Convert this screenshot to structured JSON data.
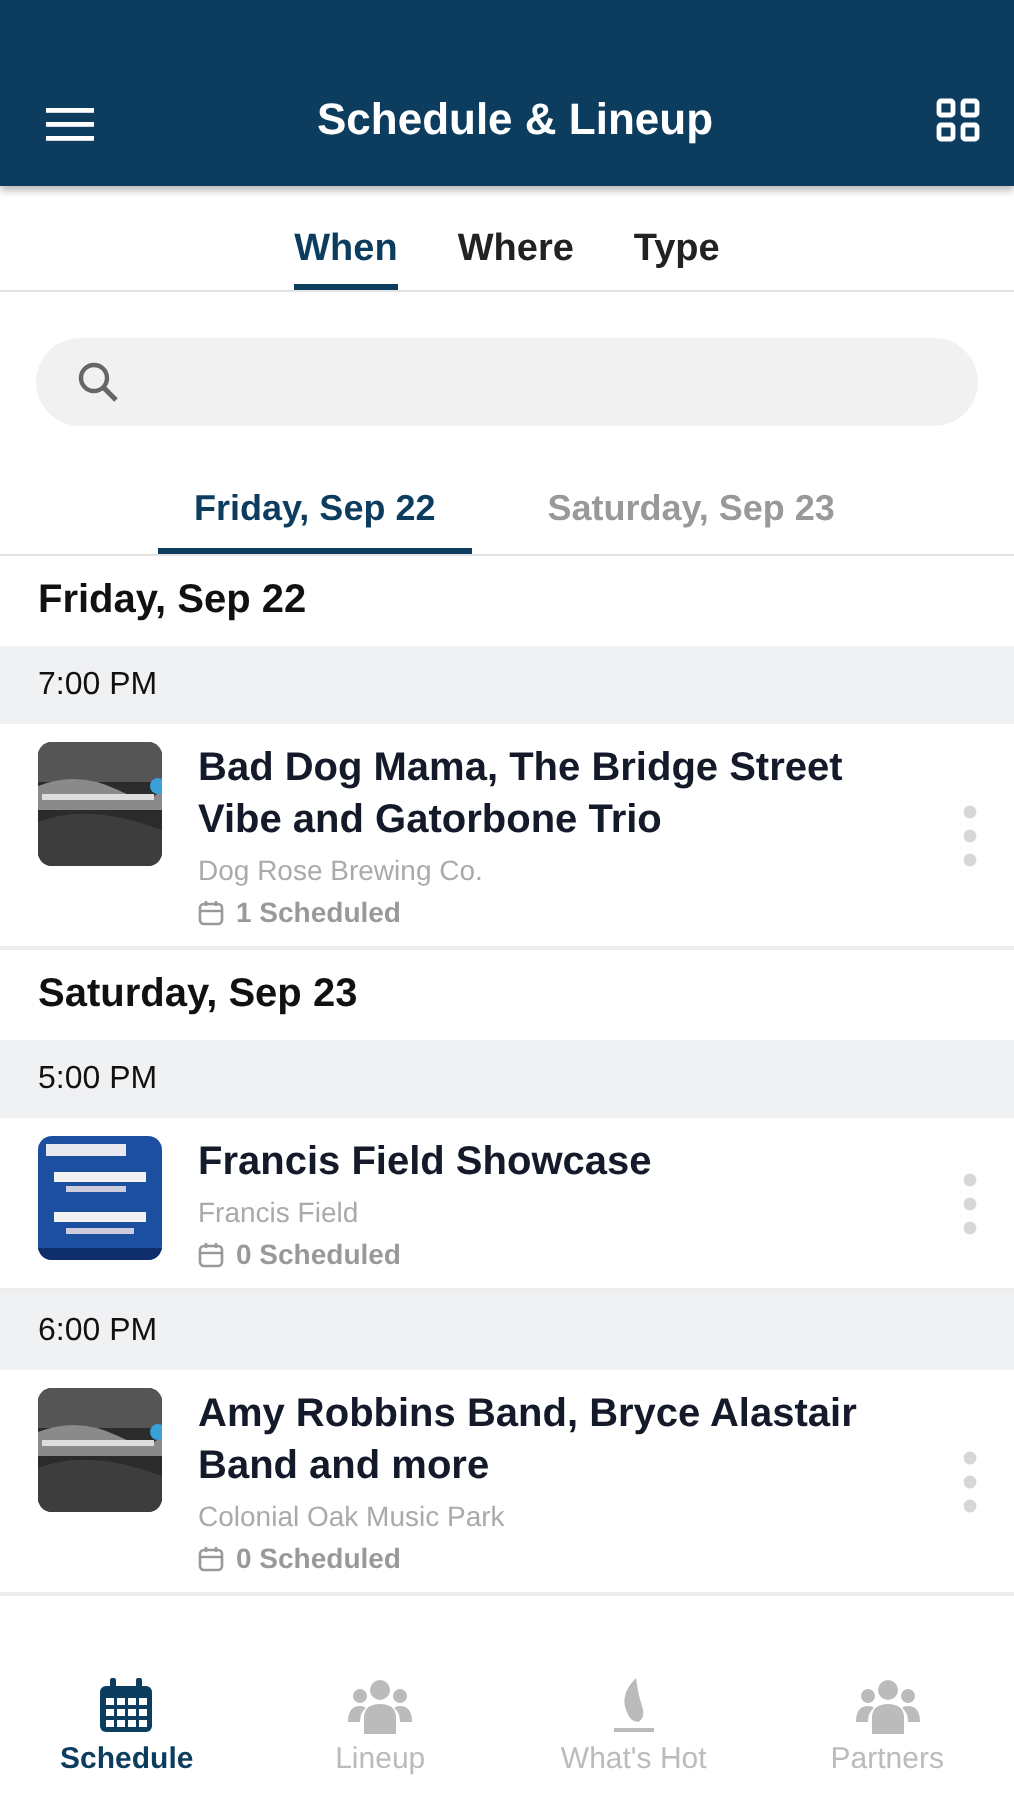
{
  "header": {
    "title": "Schedule & Lineup"
  },
  "filter_tabs": [
    {
      "label": "When",
      "selected": true
    },
    {
      "label": "Where",
      "selected": false
    },
    {
      "label": "Type",
      "selected": false
    }
  ],
  "date_tabs": [
    {
      "label": "Friday, Sep 22",
      "selected": true
    },
    {
      "label": "Saturday, Sep 23",
      "selected": false
    }
  ],
  "days": [
    {
      "title": "Friday, Sep 22",
      "slots": [
        {
          "time": "7:00 PM",
          "events": [
            {
              "title": "Bad Dog Mama, The Bridge Street Vibe and Gatorbone Trio",
              "venue": "Dog Rose Brewing Co.",
              "scheduled": "1 Scheduled"
            }
          ]
        }
      ]
    },
    {
      "title": "Saturday, Sep 23",
      "slots": [
        {
          "time": "5:00 PM",
          "events": [
            {
              "title": "Francis Field Showcase",
              "venue": "Francis Field",
              "scheduled": "0 Scheduled"
            }
          ]
        },
        {
          "time": "6:00 PM",
          "events": [
            {
              "title": "Amy Robbins Band, Bryce Alastair Band and more",
              "venue": "Colonial Oak Music Park",
              "scheduled": "0 Scheduled"
            }
          ]
        }
      ]
    }
  ],
  "bottom_nav": [
    {
      "label": "Schedule",
      "kind": "calendar",
      "selected": true
    },
    {
      "label": "Lineup",
      "kind": "people",
      "selected": false
    },
    {
      "label": "What's Hot",
      "kind": "flame",
      "selected": false
    },
    {
      "label": "Partners",
      "kind": "people",
      "selected": false
    }
  ]
}
